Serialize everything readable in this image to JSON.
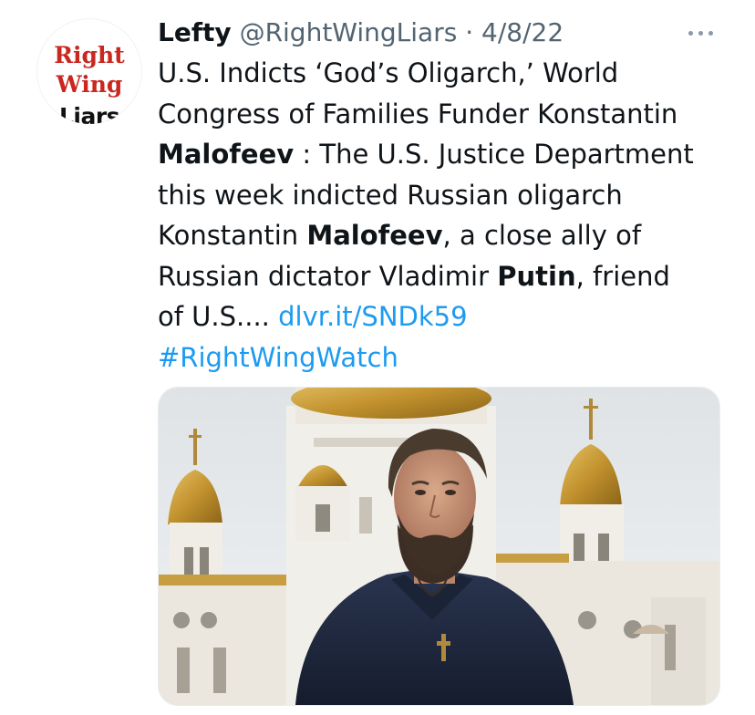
{
  "avatar": {
    "line1": "Right",
    "line2": "Wing",
    "line3": "Liars"
  },
  "tweet": {
    "display_name": "Lefty",
    "handle": "@RightWingLiars",
    "separator": " · ",
    "date": "4/8/22",
    "more_icon": "more-horizontal-icon",
    "text": {
      "l1": "U.S. Indicts ‘God’s Oligarch,’ World",
      "l2": "Congress of Families Funder Konstantin",
      "l3_bold": "Malofeev",
      "l3_rest": " : The U.S. Justice Department",
      "l4": "this week indicted Russian oligarch",
      "l5_pre": "Konstantin ",
      "l5_bold": "Malofeev",
      "l5_rest": ", a close ally of",
      "l6_pre": "Russian dictator Vladimir ",
      "l6_bold": "Putin",
      "l6_rest": ", friend",
      "l7_pre": "of U.S.... ",
      "link": "dlvr.it/SNDk59",
      "hashtag": "#RightWingWatch"
    }
  },
  "colors": {
    "text": "#0f1419",
    "secondary": "#536471",
    "link": "#1d9bf0",
    "avatar_red": "#c9271f"
  },
  "media": {
    "description_icon": "photo-man-in-front-of-cathedral"
  }
}
